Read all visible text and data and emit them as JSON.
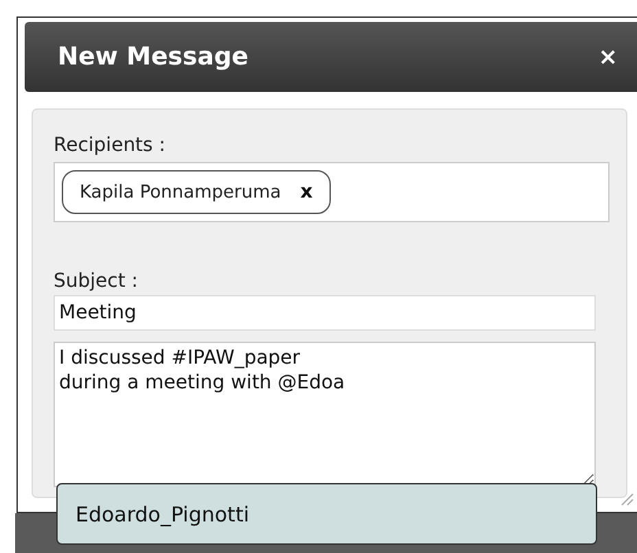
{
  "dialog": {
    "title": "New Message",
    "close": "×"
  },
  "recipients": {
    "label": "Recipients :",
    "chips": [
      {
        "name": "Kapila Ponnamperuma",
        "remove": "x"
      }
    ]
  },
  "subject": {
    "label": "Subject :",
    "value": "Meeting"
  },
  "body": {
    "value": "I discussed #IPAW_paper\nduring a meeting with @Edoa"
  },
  "suggestions": [
    {
      "label": "Edoardo_Pignotti"
    }
  ]
}
